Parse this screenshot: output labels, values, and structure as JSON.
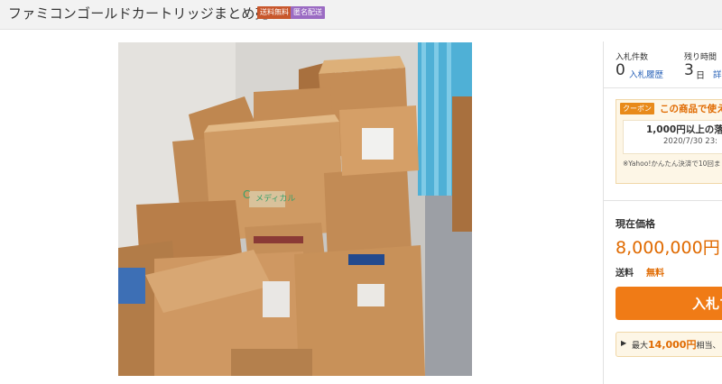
{
  "header": {
    "title": "ファミコンゴールドカートリッジまとめ売り",
    "badge_shipping": "送料無料",
    "badge_anonymous": "匿名配送"
  },
  "photo": {
    "box_label": "メディカル",
    "box_logo": "C"
  },
  "auction": {
    "bids_label": "入札件数",
    "bids_count": "0",
    "bid_history_link": "入札履歴",
    "time_left_label": "残り時間",
    "time_left_value": "3",
    "time_left_unit": "日",
    "detail_link": "詳"
  },
  "coupon": {
    "tag": "クーポン",
    "headline": "この商品で使え",
    "amount": "1,000円以上の落",
    "date": "2020/7/30 23:",
    "note": "※Yahoo!かんたん決済で10回ま"
  },
  "price": {
    "label": "現在価格",
    "value": "8,000,000円",
    "suffix": "（",
    "shipping_label": "送料",
    "shipping_value": "無料"
  },
  "bid_button": {
    "label": "入札す"
  },
  "points": {
    "prefix": "最大",
    "amount": "14,000円",
    "suffix": "相当、"
  },
  "colors": {
    "accent": "#f07b16",
    "price": "#e06a00",
    "link": "#2a63b8"
  }
}
